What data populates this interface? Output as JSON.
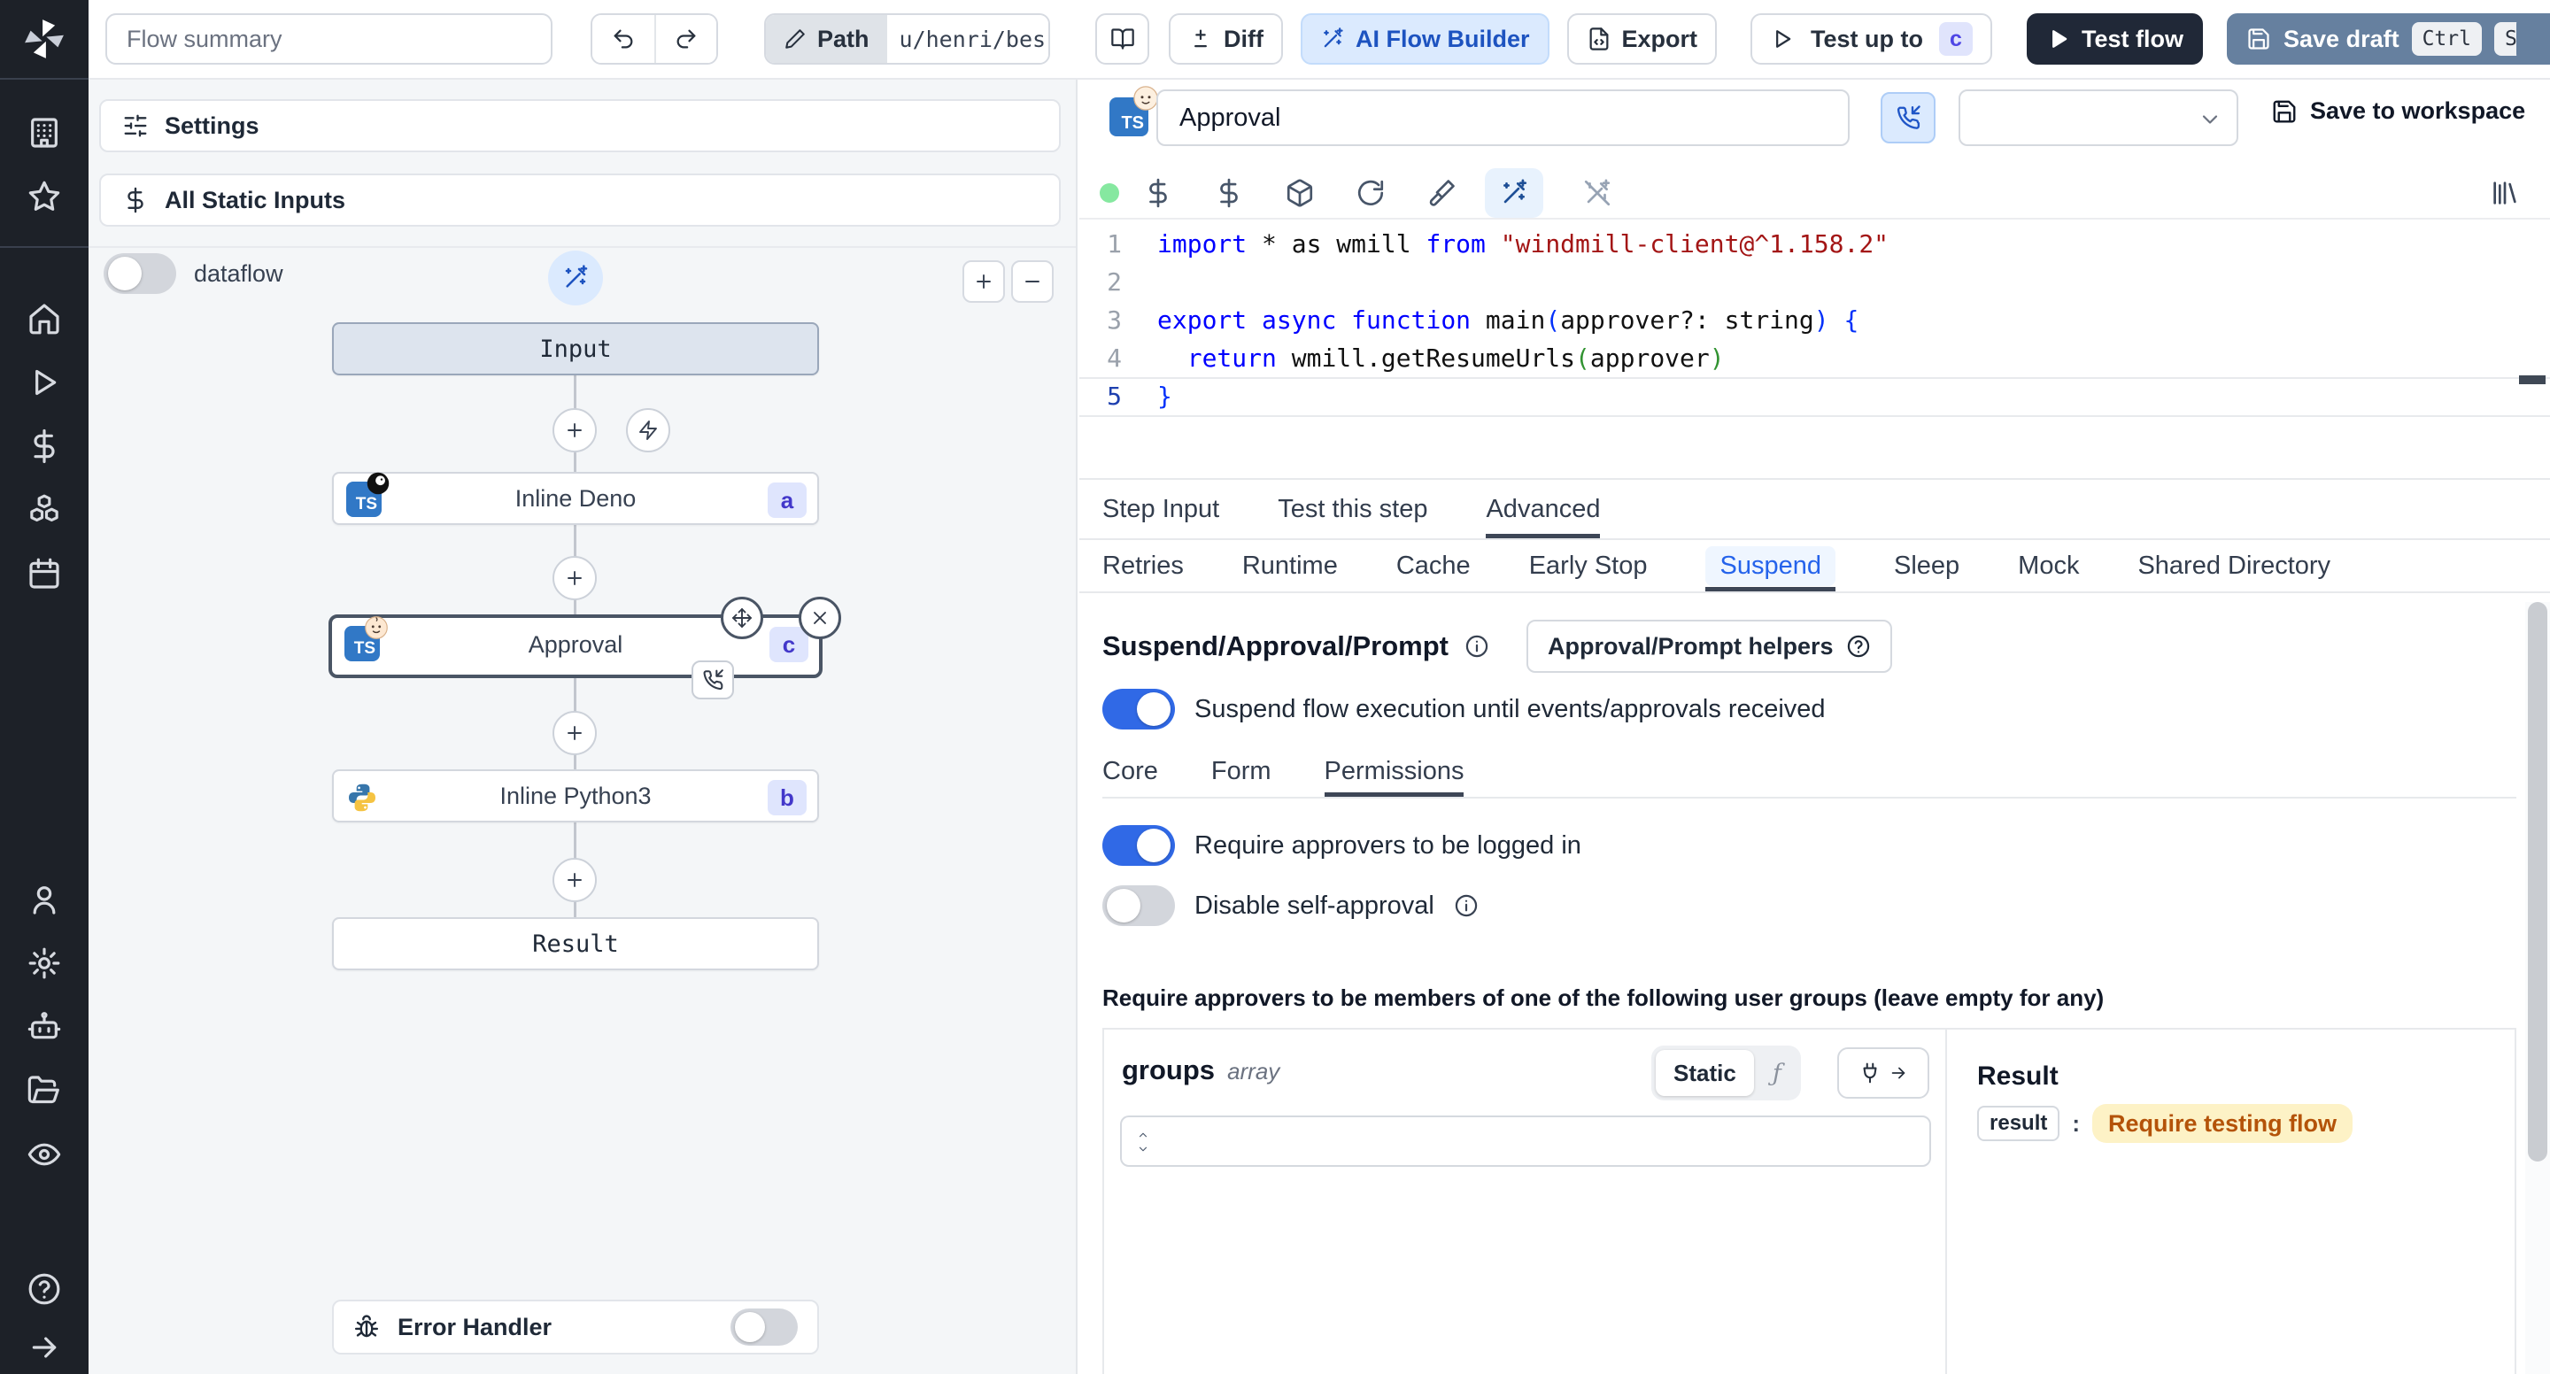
{
  "topbar": {
    "flow_summary": "Flow summary",
    "path_label": "Path",
    "path_value": "u/henri/bes",
    "diff": "Diff",
    "ai_flow_builder": "AI Flow Builder",
    "export": "Export",
    "test_up_to": "Test up to",
    "test_up_to_badge": "c",
    "test_flow": "Test flow",
    "save_draft": "Save draft",
    "kbd_ctrl": "Ctrl",
    "kbd_s": "S"
  },
  "flow_panel": {
    "settings": "Settings",
    "all_static_inputs": "All Static Inputs",
    "dataflow": "dataflow",
    "nodes": {
      "input": "Input",
      "deno": {
        "label": "Inline Deno",
        "badge": "a",
        "lang": "TS"
      },
      "approval": {
        "label": "Approval",
        "badge": "c",
        "lang": "TS"
      },
      "python": {
        "label": "Inline Python3",
        "badge": "b"
      },
      "result": "Result"
    },
    "error_handler": "Error Handler"
  },
  "editor": {
    "step_name": "Approval",
    "lang": "TS",
    "save_to_workspace": "Save to workspace",
    "code": {
      "lines": [
        [
          {
            "t": "import",
            "c": "kw"
          },
          {
            "t": " * as wmill ",
            "c": "tx"
          },
          {
            "t": "from",
            "c": "kw"
          },
          {
            "t": " ",
            "c": "tx"
          },
          {
            "t": "\"windmill-client@^1.158.2\"",
            "c": "str"
          }
        ],
        [],
        [
          {
            "t": "export",
            "c": "kw"
          },
          {
            "t": " ",
            "c": "tx"
          },
          {
            "t": "async",
            "c": "kw"
          },
          {
            "t": " ",
            "c": "tx"
          },
          {
            "t": "function",
            "c": "kw"
          },
          {
            "t": " main",
            "c": "tx"
          },
          {
            "t": "(",
            "c": "p1"
          },
          {
            "t": "approver?: string",
            "c": "tx"
          },
          {
            "t": ")",
            "c": "p1"
          },
          {
            "t": " ",
            "c": "tx"
          },
          {
            "t": "{",
            "c": "p1"
          }
        ],
        [
          {
            "t": "  ",
            "c": "tx"
          },
          {
            "t": "return",
            "c": "kw"
          },
          {
            "t": " wmill.getResumeUrls",
            "c": "tx"
          },
          {
            "t": "(",
            "c": "p2"
          },
          {
            "t": "approver",
            "c": "tx"
          },
          {
            "t": ")",
            "c": "p2"
          }
        ],
        [
          {
            "t": "}",
            "c": "p1"
          }
        ]
      ]
    }
  },
  "tabs": {
    "main": [
      "Step Input",
      "Test this step",
      "Advanced"
    ],
    "sub": [
      "Retries",
      "Runtime",
      "Cache",
      "Early Stop",
      "Suspend",
      "Sleep",
      "Mock",
      "Shared Directory"
    ]
  },
  "suspend": {
    "heading": "Suspend/Approval/Prompt",
    "helpers": "Approval/Prompt helpers",
    "suspend_toggle": "Suspend flow execution until events/approvals received",
    "subtabs": [
      "Core",
      "Form",
      "Permissions"
    ],
    "require_login": "Require approvers to be logged in",
    "disable_self": "Disable self-approval",
    "members_note": "Require approvers to be members of one of the following user groups (leave empty for any)",
    "groups_label": "groups",
    "groups_type": "array",
    "static_label": "Static",
    "fn_symbol": "ƒ",
    "result_heading": "Result",
    "result_key": "result",
    "result_value": "Require testing flow"
  }
}
